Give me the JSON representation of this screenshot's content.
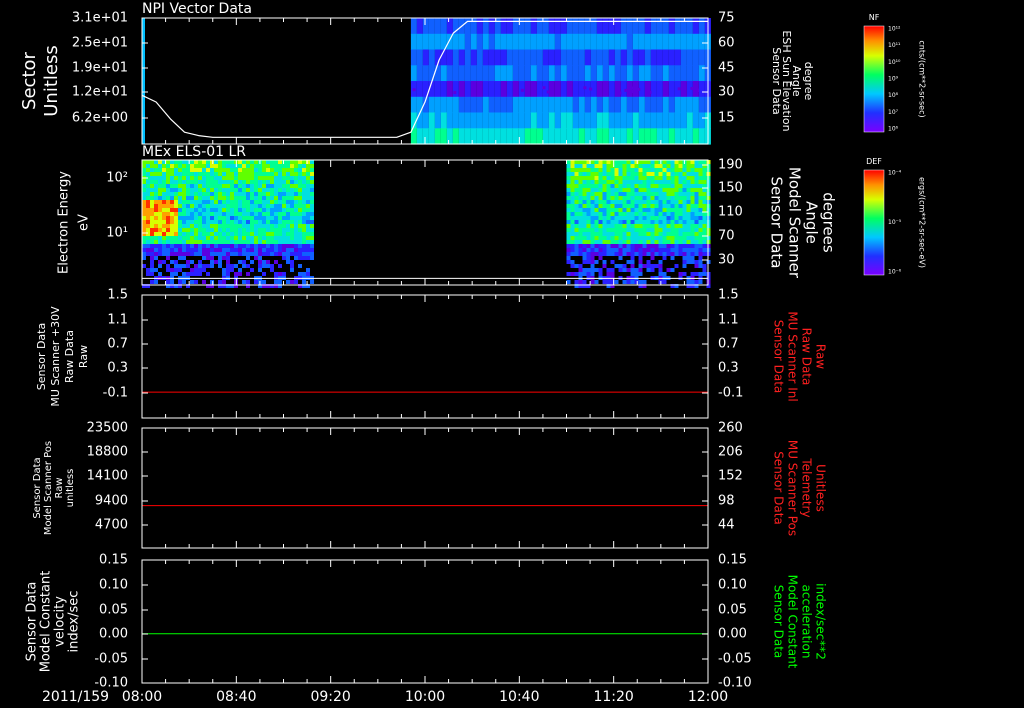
{
  "time_axis": {
    "date_label": "2011/159",
    "ticks": [
      "08:00",
      "08:40",
      "09:20",
      "10:00",
      "10:40",
      "11:20",
      "12:00"
    ]
  },
  "chart_data": [
    {
      "type": "heatmap",
      "title": "NPI Vector Data",
      "ylabel": [
        "Sector",
        "Unitless"
      ],
      "yticks": [
        "3.1e+01",
        "2.5e+01",
        "1.9e+01",
        "1.2e+01",
        "6.2e+00"
      ],
      "y2label": [
        "Sensor Data",
        "ESH Sun Elevation",
        "Angle",
        "degree"
      ],
      "y2ticks": [
        "75",
        "60",
        "45",
        "30",
        "15"
      ],
      "y2lim": [
        0,
        75
      ],
      "overlay_line": {
        "x_hours": [
          8.0,
          8.1,
          8.2,
          8.3,
          8.4,
          8.5,
          9.0,
          9.5,
          9.8,
          9.9,
          10.0,
          10.1,
          10.2,
          10.3,
          10.5,
          12.0
        ],
        "y": [
          29,
          25,
          15,
          7,
          5,
          4,
          4,
          4,
          4,
          7,
          25,
          50,
          66,
          73,
          73,
          73
        ]
      },
      "data_coverage_hours": [
        [
          9.9,
          12.0
        ]
      ],
      "colorbar": {
        "label": "NF",
        "unit": "cnts/(cm**2-sr-sec)",
        "ticks": [
          "10¹²",
          "10¹¹",
          "10¹⁰",
          "10⁹",
          "10⁸",
          "10⁷",
          "10⁶"
        ]
      }
    },
    {
      "type": "heatmap",
      "title": "MEx ELS-01 LR",
      "ylabel": [
        "Electron Energy",
        "eV"
      ],
      "yticks": [
        "10²",
        "10¹"
      ],
      "y2label": [
        "Sensor Data",
        "Model Scanner",
        "Angle",
        "degrees"
      ],
      "y2ticks": [
        "190",
        "150",
        "110",
        "70",
        "30"
      ],
      "y2lim": [
        0,
        190
      ],
      "overlay_line": {
        "x_hours": [
          8.0,
          12.0
        ],
        "y": [
          10,
          10
        ]
      },
      "data_coverage_hours": [
        [
          8.0,
          9.2
        ],
        [
          11.0,
          12.0
        ]
      ],
      "colorbar": {
        "label": "DEF",
        "unit": "ergs/(cm**2-sr-sec-eV)",
        "ticks": [
          "10⁻⁴",
          "10⁻⁵",
          "10⁻⁶"
        ]
      }
    },
    {
      "type": "line",
      "ylabel": [
        "Sensor Data",
        "MU Scanner +30V",
        "Raw Data",
        "Raw"
      ],
      "yticks": [
        "1.5",
        "1.1",
        "0.7",
        "0.3",
        "-0.1"
      ],
      "ylim": [
        -0.4,
        1.5
      ],
      "y2label": [
        "Sensor Data",
        "MU Scanner Inl",
        "Raw Data",
        "Raw"
      ],
      "y2ticks": [
        "1.5",
        "1.1",
        "0.7",
        "0.3",
        "-0.1"
      ],
      "color": "#ff0000",
      "series": [
        {
          "x_hours": [
            8.0,
            12.0
          ],
          "values": [
            0.0,
            0.0
          ]
        }
      ]
    },
    {
      "type": "line",
      "ylabel": [
        "Sensor Data",
        "Model Scanner Pos",
        "Raw",
        "unitless"
      ],
      "yticks": [
        "23500",
        "18800",
        "14100",
        "9400",
        "4700"
      ],
      "ylim": [
        0,
        23500
      ],
      "y2label": [
        "Sensor Data",
        "MU Scanner Pos",
        "Telemetry",
        "Unitless"
      ],
      "y2ticks": [
        "260",
        "206",
        "152",
        "98",
        "44"
      ],
      "color": "#ff0000",
      "series": [
        {
          "x_hours": [
            8.0,
            12.0
          ],
          "values": [
            8300,
            8300
          ]
        }
      ]
    },
    {
      "type": "line",
      "ylabel": [
        "Sensor Data",
        "Model Constant",
        "velocity",
        "index/sec"
      ],
      "yticks": [
        "0.15",
        "0.10",
        "0.05",
        "0.00",
        "-0.05",
        "-0.10"
      ],
      "ylim": [
        -0.1,
        0.15
      ],
      "y2label": [
        "Sensor Data",
        "Model Constant",
        "acceleration",
        "index/sec**2"
      ],
      "y2ticks": [
        "0.15",
        "0.10",
        "0.05",
        "0.00",
        "-0.05",
        "-0.10"
      ],
      "color": "#00ff00",
      "series": [
        {
          "x_hours": [
            8.0,
            12.0
          ],
          "values": [
            0.0,
            0.0
          ]
        }
      ]
    }
  ]
}
